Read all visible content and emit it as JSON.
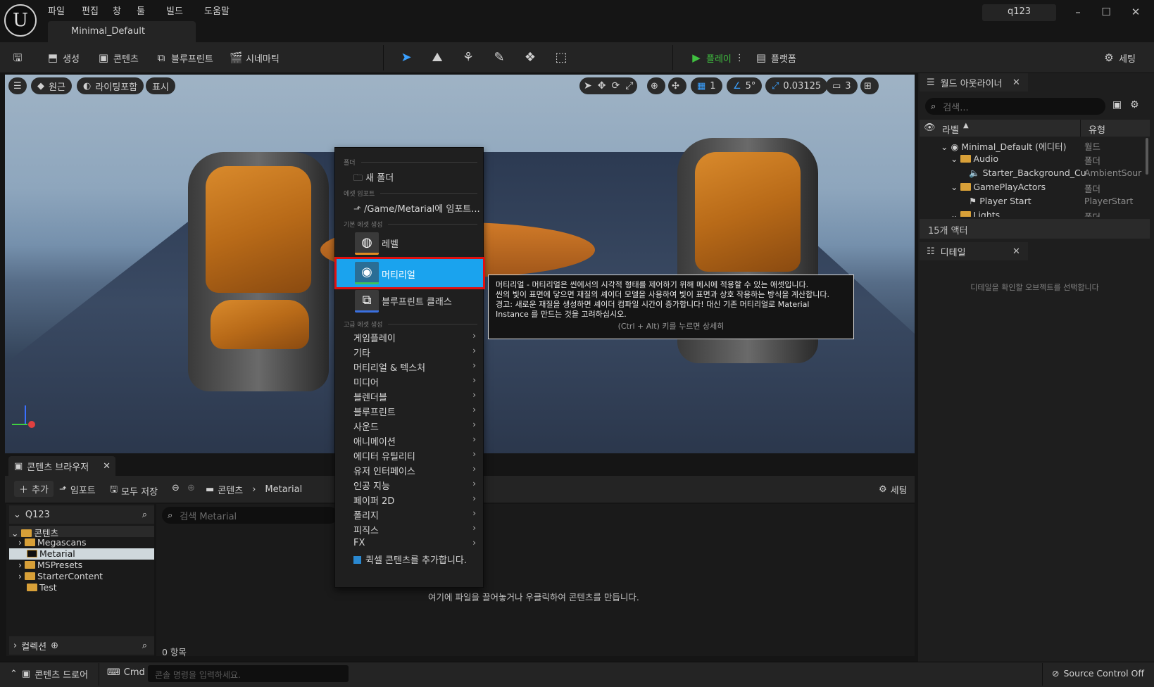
{
  "window": {
    "menu": [
      "파일",
      "편집",
      "창",
      "툴",
      "빌드",
      "도움말"
    ],
    "level_tab": "Minimal_Default",
    "project_name": "q123",
    "controls": {
      "minimize": "–",
      "maximize": "☐",
      "close": "✕"
    }
  },
  "toolbar": {
    "create": "생성",
    "content": "콘텐츠",
    "blueprint": "블루프린트",
    "cinematics": "시네마틱",
    "play": "플레이",
    "platforms": "플랫폼",
    "settings": "세팅",
    "play_color": "#40c040"
  },
  "viewport": {
    "perspective": "원근",
    "lighting": "라이팅포함",
    "show": "표시",
    "grid_snap": "1",
    "rotation_snap": "5°",
    "scale_snap": "0.03125",
    "camera_speed": "3"
  },
  "context_menu": {
    "section_folder": "폴더",
    "new_folder": "새 폴더",
    "section_import": "에셋 임포트",
    "import_to": "/Game/Metarial에 임포트...",
    "section_basic": "기본 에셋 생성",
    "level": "레벨",
    "material": "머티리얼",
    "blueprint_class": "블루프린트 클래스",
    "section_advanced": "고급 에셋 생성",
    "submenus": [
      "게임플레이",
      "기타",
      "머티리얼 & 텍스처",
      "미디어",
      "블렌더블",
      "블루프린트",
      "사운드",
      "애니메이션",
      "에디터 유틸리티",
      "유저 인터페이스",
      "인공 지능",
      "페이퍼 2D",
      "폴리지",
      "피직스",
      "FX"
    ],
    "quixel": "퀵셀 콘텐츠를 추가합니다.",
    "highlight_color": "#1aa3ee",
    "annotation_color": "#e01010"
  },
  "tooltip": {
    "line1": "머티리얼 - 머티리얼은 씬에서의 시각적 형태를 제어하기 위해 메시에 적용할 수 있는 애셋입니다.",
    "line2": "씬의 빛이 표면에 닿으면 재질의 셰이더 모델을 사용하여 빛이 표면과 상호 작용하는 방식을 계산합니다.",
    "line3": "경고: 새로운 재질을 생성하면 셰이더 컴파일 시간이 증가합니다! 대신 기존 머티리얼로 Material",
    "line4": "Instance 를 만드는 것을 고려하십시오.",
    "hint": "(Ctrl + Alt) 키를 누르면 상세히"
  },
  "outliner": {
    "tab": "월드 아웃라이너",
    "search_placeholder": "검색...",
    "col_label": "라벨",
    "col_type": "유형",
    "rows": [
      {
        "name": "Minimal_Default (에디터)",
        "type": "월드"
      },
      {
        "name": "Audio",
        "type": "폴더"
      },
      {
        "name": "Starter_Background_Cu",
        "type": "AmbientSour"
      },
      {
        "name": "GamePlayActors",
        "type": "폴더"
      },
      {
        "name": "Player Start",
        "type": "PlayerStart"
      },
      {
        "name": "Lights",
        "type": "폴더"
      }
    ],
    "actor_count": "15개 액터"
  },
  "details": {
    "tab": "디테일",
    "empty": "디테일을 확인할 오브젝트를 선택합니다"
  },
  "content_browser": {
    "tab": "콘텐츠 브라우저",
    "add": "추가",
    "import": "임포트",
    "save_all": "모두 저장",
    "path_root": "콘텐츠",
    "path_leaf": "Metarial",
    "settings": "세팅",
    "project_root": "Q123",
    "search_placeholder": "검색 Metarial",
    "tree": {
      "content": "콘텐츠",
      "megascans": "Megascans",
      "metarial": "Metarial",
      "mspresets": "MSPresets",
      "starter": "StarterContent",
      "test": "Test"
    },
    "collections": "컬렉션",
    "drop_hint": "여기에 파일을 끌어놓거나 우클릭하여 콘텐츠를 만듭니다.",
    "item_count": "0 항목"
  },
  "statusbar": {
    "content_drawer": "콘텐츠 드로어",
    "cmd": "Cmd",
    "console_placeholder": "콘솔 명령을 입력하세요.",
    "source_control": "Source Control Off"
  }
}
